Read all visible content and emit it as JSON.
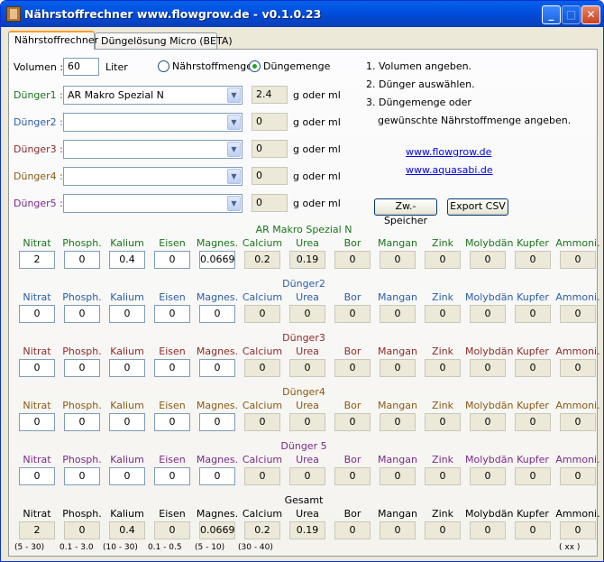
{
  "window": {
    "title": "Nährstoffrechner www.flowgrow.de - v0.1.0.23",
    "min": "_",
    "max": "□",
    "close": "✕"
  },
  "tabs": [
    {
      "label": "Nährstoffrechner"
    },
    {
      "label": "Düngelösung Micro (BETA)"
    }
  ],
  "volume": {
    "label": "Volumen :",
    "value": "60",
    "unit": "Liter"
  },
  "mode": {
    "option1": "Nährstoffmenge",
    "option2": "Düngemenge",
    "selected": "Düngemenge"
  },
  "duenger": [
    {
      "label": "Dünger1 :",
      "selected": "AR Makro Spezial N",
      "amount": "2.4",
      "unit": "g oder ml"
    },
    {
      "label": "Dünger2 :",
      "selected": "",
      "amount": "0",
      "unit": "g oder ml"
    },
    {
      "label": "Dünger3 :",
      "selected": "",
      "amount": "0",
      "unit": "g oder ml"
    },
    {
      "label": "Dünger4 :",
      "selected": "",
      "amount": "0",
      "unit": "g oder ml"
    },
    {
      "label": "Dünger5 :",
      "selected": "",
      "amount": "0",
      "unit": "g oder ml"
    }
  ],
  "instructions": [
    "1. Volumen angeben.",
    "2. Dünger auswählen.",
    "3. Düngemenge oder",
    "gewünschte Nährstoffmenge angeben."
  ],
  "links": [
    "www.flowgrow.de",
    "www.aquasabi.de"
  ],
  "buttons": {
    "zw": "Zw.-Speicher",
    "csv": "Export CSV"
  },
  "columns": [
    "Nitrat",
    "Phosph.",
    "Kalium",
    "Eisen",
    "Magnes.",
    "Calcium",
    "Urea",
    "Bor",
    "Mangan",
    "Zink",
    "Molybdän",
    "Kupfer",
    "Ammoni."
  ],
  "sections": [
    {
      "title": "AR Makro Spezial N",
      "values": [
        "2",
        "0",
        "0.4",
        "0",
        "0.0669",
        "0.2",
        "0.19",
        "0",
        "0",
        "0",
        "0",
        "0",
        "0"
      ]
    },
    {
      "title": "Dünger2",
      "values": [
        "0",
        "0",
        "0",
        "0",
        "0",
        "0",
        "0",
        "0",
        "0",
        "0",
        "0",
        "0",
        "0"
      ]
    },
    {
      "title": "Dünger3",
      "values": [
        "0",
        "0",
        "0",
        "0",
        "0",
        "0",
        "0",
        "0",
        "0",
        "0",
        "0",
        "0",
        "0"
      ]
    },
    {
      "title": "Dünger4",
      "values": [
        "0",
        "0",
        "0",
        "0",
        "0",
        "0",
        "0",
        "0",
        "0",
        "0",
        "0",
        "0",
        "0"
      ]
    },
    {
      "title": "Dünger 5",
      "values": [
        "0",
        "0",
        "0",
        "0",
        "0",
        "0",
        "0",
        "0",
        "0",
        "0",
        "0",
        "0",
        "0"
      ]
    },
    {
      "title": "Gesamt",
      "values": [
        "2",
        "0",
        "0.4",
        "0",
        "0.0669",
        "0.2",
        "0.19",
        "0",
        "0",
        "0",
        "0",
        "0",
        "0"
      ]
    }
  ],
  "ranges": [
    "(5 - 30)",
    "0.1 - 3.0",
    "(10 - 30)",
    "0.1 - 0.5",
    "(5 - 10)",
    "(30 - 40)",
    "( xx )"
  ],
  "colors": {
    "s1": "#197519",
    "s2": "#2b5ea8",
    "s3": "#8a2c2c",
    "s4": "#8a5a12",
    "s5": "#7a2a8a",
    "s6": "#000000"
  }
}
